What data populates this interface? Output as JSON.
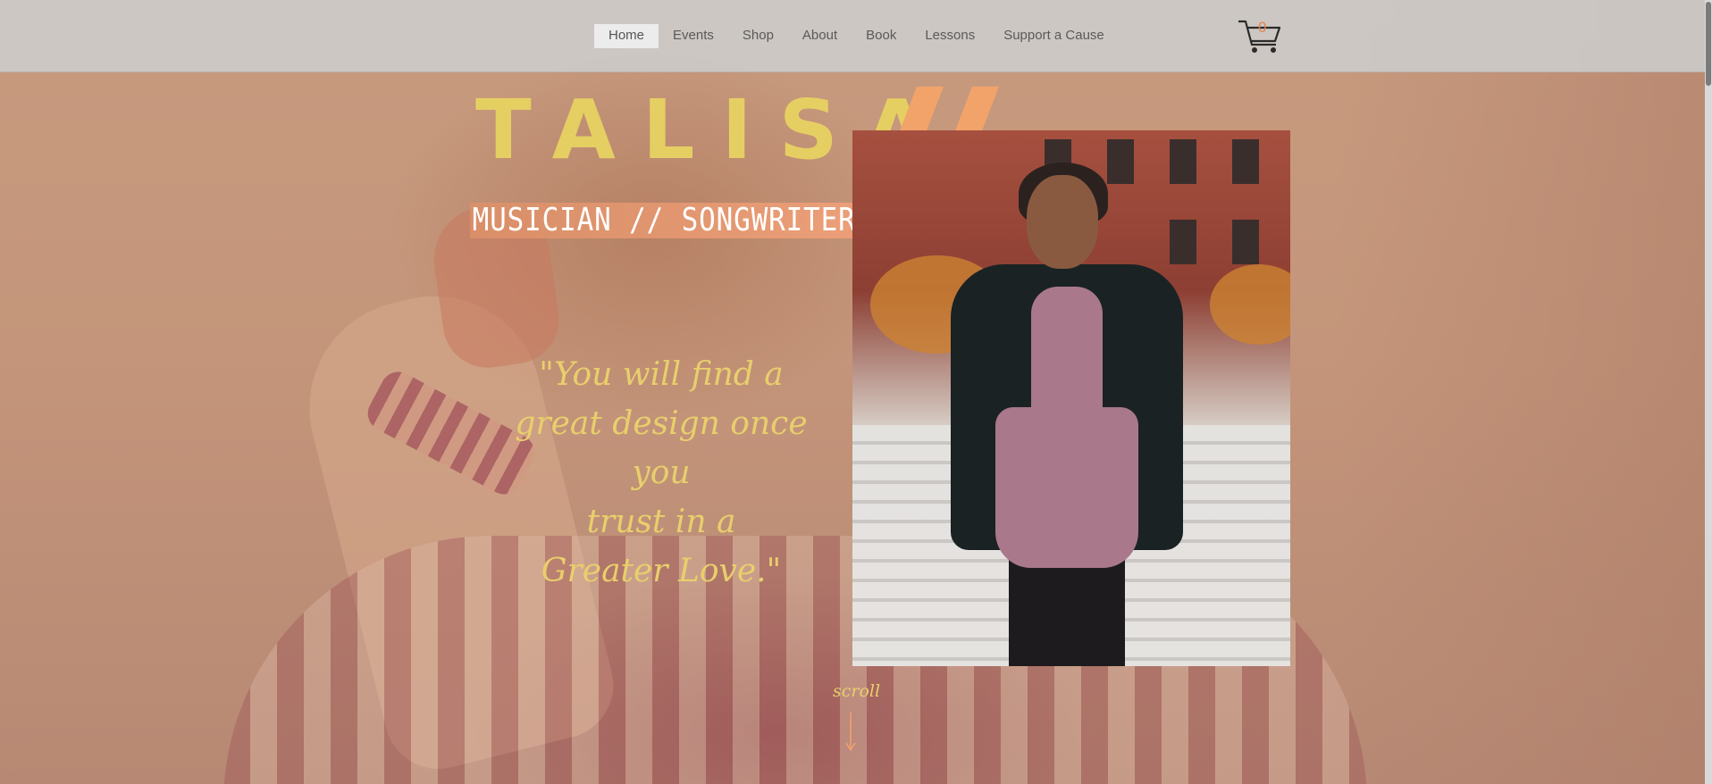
{
  "nav": {
    "items": [
      {
        "label": "Home",
        "active": true
      },
      {
        "label": "Events",
        "active": false
      },
      {
        "label": "Shop",
        "active": false
      },
      {
        "label": "About",
        "active": false
      },
      {
        "label": "Book",
        "active": false
      },
      {
        "label": "Lessons",
        "active": false
      },
      {
        "label": "Support a Cause",
        "active": false
      }
    ]
  },
  "cart": {
    "count": "0",
    "icon": "shopping-cart-icon"
  },
  "hero": {
    "title": "TALISA",
    "title_accent": "//",
    "tagline": "MUSICIAN // SONGWRITER",
    "quote_lines": [
      "\"You will find a",
      "great design once you",
      "trust in a",
      "Greater Love.\""
    ],
    "scroll_label": "scroll"
  },
  "colors": {
    "title": "#e5cf62",
    "accent": "#f2a36a",
    "quote": "#e8cf6c",
    "background": "#c79a7e",
    "header": "#cdcdcd"
  }
}
